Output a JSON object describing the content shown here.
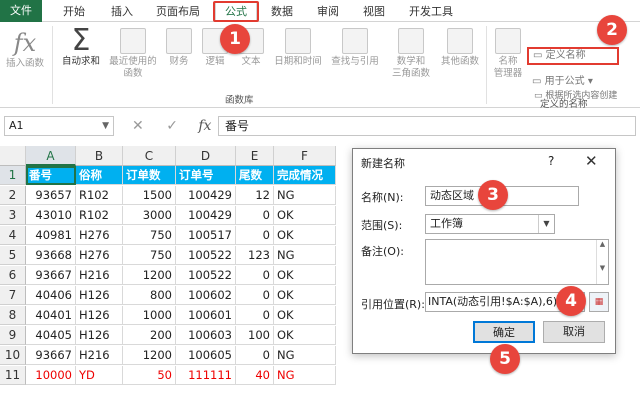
{
  "ribbon_tabs": [
    "文件",
    "开始",
    "插入",
    "页面布局",
    "公式",
    "数据",
    "审阅",
    "视图",
    "开发工具"
  ],
  "ribbon": {
    "insert_function": "插入函数",
    "autosum": "自动求和",
    "recent_used": [
      "最近使用的",
      "函数"
    ],
    "financial": "财务",
    "logical": "逻辑",
    "text": "文本",
    "datetime": "日期和时间",
    "lookup": "查找与引用",
    "math": [
      "数学和",
      "三角函数"
    ],
    "other": "其他函数",
    "group_function_lib": "函数库",
    "name_manager": [
      "名称",
      "管理器"
    ],
    "define_name": "定义名称",
    "use_in_formula": "用于公式",
    "create_from_selection": "根据所选内容创建",
    "group_defined_names": "定义的名称"
  },
  "formula_bar": {
    "name_box": "A1",
    "icons": [
      "✕",
      "✓",
      "fx"
    ],
    "content": "番号"
  },
  "sheet": {
    "columns": [
      "A",
      "B",
      "C",
      "D",
      "E",
      "F"
    ],
    "rows": [
      "1",
      "2",
      "3",
      "4",
      "5",
      "6",
      "7",
      "8",
      "9",
      "10",
      "11"
    ],
    "header": [
      "番号",
      "俗称",
      "订单数",
      "订单号",
      "尾数",
      "完成情况"
    ],
    "data": [
      [
        "93657",
        "R102",
        "1500",
        "100429",
        "12",
        "NG"
      ],
      [
        "43010",
        "R102",
        "3000",
        "100429",
        "0",
        "OK"
      ],
      [
        "40981",
        "H276",
        "750",
        "100517",
        "0",
        "OK"
      ],
      [
        "93668",
        "H276",
        "750",
        "100522",
        "123",
        "NG"
      ],
      [
        "93667",
        "H216",
        "1200",
        "100522",
        "0",
        "OK"
      ],
      [
        "40406",
        "H126",
        "800",
        "100602",
        "0",
        "OK"
      ],
      [
        "40401",
        "H126",
        "1000",
        "100601",
        "0",
        "OK"
      ],
      [
        "40405",
        "H126",
        "200",
        "100603",
        "100",
        "OK"
      ],
      [
        "93667",
        "H216",
        "1200",
        "100605",
        "0",
        "NG"
      ],
      [
        "10000",
        "YD",
        "50",
        "111111",
        "40",
        "NG"
      ]
    ]
  },
  "dialog": {
    "title": "新建名称",
    "help": "?",
    "close": "✕",
    "name_label": "名称(N):",
    "name_value": "动态区域",
    "scope_label": "范围(S):",
    "scope_value": "工作簿",
    "comment_label": "备注(O):",
    "ref_label": "引用位置(R):",
    "ref_value": "INTA(动态引用!$A:$A),6)",
    "ok": "确定",
    "cancel": "取消"
  },
  "callouts": [
    "1",
    "2",
    "3",
    "4",
    "5"
  ],
  "colors": {
    "accent": "#217346",
    "header_fill": "#00b0f0",
    "callout": "#e8453c",
    "highlight_box": "#e23b30",
    "last_row_text": "#ee0000"
  }
}
